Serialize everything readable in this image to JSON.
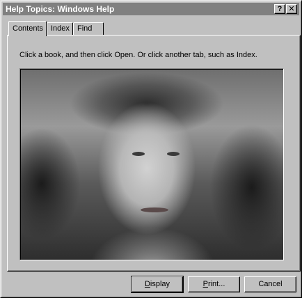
{
  "window": {
    "title": "Help Topics: Windows Help",
    "help_button": "?",
    "close_button": "✕"
  },
  "tabs": [
    {
      "label": "Contents",
      "active": true
    },
    {
      "label": "Index",
      "active": false
    },
    {
      "label": "Find",
      "active": false
    }
  ],
  "contents": {
    "instruction": "Click a book, and then click Open. Or click another tab, such as Index."
  },
  "buttons": {
    "display": {
      "first": "D",
      "rest": "isplay"
    },
    "print": {
      "first": "P",
      "rest": "rint..."
    },
    "cancel": "Cancel"
  }
}
